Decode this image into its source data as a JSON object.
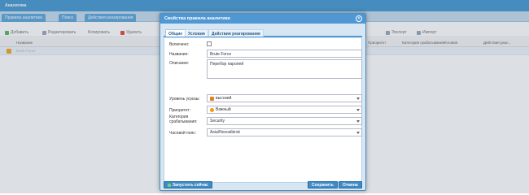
{
  "app": {
    "title": "Аналитика",
    "tabs": [
      "Правила аналитики",
      "Поиск",
      "Действия реагирования"
    ],
    "toolbar": [
      "Добавить",
      "Редактировать",
      "Копировать",
      "Удалить",
      "Экспорт",
      "Импорт"
    ],
    "grid_headers": [
      "Название",
      "Приоритет",
      "Категория срабатывания",
      "Условия",
      "Действия реаг..."
    ],
    "grid_row_text": "Brute Force"
  },
  "dialog": {
    "title": "Свойства правила аналитики",
    "close_icon": "close-icon",
    "tabs": [
      "Общие",
      "Условия",
      "Действия реагирования"
    ],
    "fields": {
      "enabled_label": "Включено:",
      "name_label": "Название:",
      "name_value": "Brute Force",
      "description_label": "Описание:",
      "description_value": "Перебор паролей",
      "threat_label": "Уровень угрозы:",
      "threat_value": "высокий",
      "priority_label": "Приоритет:",
      "priority_value": "Важный",
      "category_label": "Категория срабатывания:",
      "category_value": "Security",
      "timezone_label": "Часовой пояс:",
      "timezone_value": "Asia/Novosibirsk"
    },
    "footer": {
      "run_label": "Запустить сейчас",
      "save_label": "Сохранить",
      "cancel_label": "Отмена"
    }
  }
}
